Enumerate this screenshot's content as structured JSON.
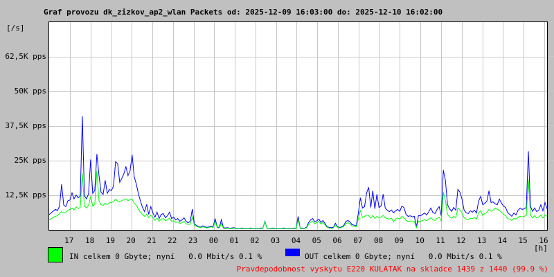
{
  "title": "Graf provozu dk_zizkov_ap2_wlan Packets od: 2025-12-09 16:03:00 do: 2025-12-10 16:02:00",
  "colors": {
    "in_series": "#00ff00",
    "out_series": "#0000ff",
    "grid": "#c6c6c6",
    "plot_background": "#ffffff",
    "page_background": "#c0c0c0",
    "alert_text": "#ff0000",
    "border": "#000000"
  },
  "y_axis": {
    "unit_label": "[/s]",
    "tick_labels": [
      "62,5K pps",
      "50K pps",
      "37,5K pps",
      "25K pps",
      "12,5K pps"
    ],
    "tick_values_kpps": [
      62.5,
      50,
      37.5,
      25,
      12.5
    ]
  },
  "x_axis": {
    "unit_label": "[h]",
    "tick_labels": [
      "17",
      "18",
      "19",
      "20",
      "21",
      "22",
      "23",
      "00",
      "01",
      "02",
      "03",
      "04",
      "05",
      "06",
      "07",
      "08",
      "09",
      "10",
      "11",
      "12",
      "13",
      "14",
      "15",
      "16"
    ]
  },
  "legend": {
    "in_label": "IN celkem 0 Gbyte; nyní   0.0 Mbit/s 0.1 %",
    "out_label": "OUT celkem 0 Gbyte; nyní   0.0 Mbit/s 0.1 %"
  },
  "footer": {
    "note": "Pravdepodobnost vyskytu E220 KULATAK na skladce 1439 z 1440 (99.9 %)"
  },
  "chart_data": {
    "type": "line",
    "title": "Graf provozu dk_zizkov_ap2_wlan Packets od: 2025-12-09 16:03:00 do: 2025-12-10 16:02:00",
    "x_start": "2025-12-09 16:03:00",
    "x_end": "2025-12-10 16:02:00",
    "x_step_minutes": 6,
    "xlabel": "[h]",
    "ylabel": "[/s]",
    "y_unit": "pps",
    "values_unit": "kpps",
    "ylim": [
      0,
      75
    ],
    "grid": true,
    "legend_position": "bottom",
    "y_gridlines_kpps": [
      12.5,
      25,
      37.5,
      50,
      62.5
    ],
    "series": [
      {
        "name": "OUT",
        "color": "#0000ff",
        "values": [
          5.5,
          6.2,
          6.8,
          7.4,
          7.0,
          8.6,
          16.5,
          9.0,
          8.4,
          10.5,
          10.8,
          13.4,
          11.2,
          12.6,
          11.6,
          12.2,
          41.0,
          12.4,
          11.2,
          13.1,
          25.4,
          13.2,
          14.3,
          27.4,
          19.8,
          13.6,
          12.8,
          17.9,
          13.2,
          14.6,
          14.2,
          15.8,
          24.6,
          23.9,
          17.2,
          18.6,
          20.2,
          22.9,
          19.6,
          21.3,
          27.1,
          19.2,
          16.6,
          13.1,
          10.4,
          8.1,
          6.6,
          9.2,
          5.6,
          8.4,
          6.1,
          4.6,
          6.4,
          4.1,
          5.6,
          5.9,
          4.4,
          5.1,
          6.4,
          4.1,
          4.6,
          3.6,
          4.1,
          3.1,
          3.6,
          4.4,
          3.1,
          2.6,
          3.1,
          7.5,
          2.1,
          1.6,
          1.2,
          1.0,
          1.5,
          1.2,
          0.9,
          1.1,
          1.4,
          1.2,
          4.1,
          1.0,
          0.9,
          3.7,
          0.8,
          0.7,
          0.8,
          0.6,
          0.7,
          0.8,
          0.6,
          0.5,
          0.6,
          0.7,
          0.5,
          0.6,
          0.5,
          0.7,
          0.6,
          0.5,
          0.6,
          0.5,
          0.7,
          0.6,
          3.1,
          0.6,
          0.5,
          0.6,
          0.7,
          0.5,
          0.5,
          0.6,
          0.5,
          0.7,
          0.6,
          0.5,
          0.6,
          0.5,
          0.7,
          0.6,
          4.9,
          0.6,
          0.7,
          0.6,
          0.9,
          2.6,
          3.6,
          4.1,
          2.9,
          3.3,
          3.9,
          2.7,
          3.4,
          2.3,
          1.1,
          0.9,
          0.8,
          0.9,
          2.4,
          1.1,
          0.9,
          1.1,
          1.6,
          3.1,
          3.4,
          2.9,
          1.9,
          1.7,
          1.5,
          5.9,
          11.6,
          7.9,
          8.4,
          13.4,
          15.4,
          8.1,
          14.1,
          7.6,
          12.9,
          8.1,
          8.6,
          12.9,
          7.9,
          7.1,
          6.6,
          7.2,
          6.2,
          6.9,
          7.4,
          6.7,
          8.6,
          8.1,
          5.6,
          4.9,
          5.1,
          4.7,
          4.9,
          1.1,
          5.2,
          5.1,
          5.6,
          6.1,
          5.4,
          6.6,
          7.9,
          6.2,
          5.9,
          7.4,
          8.4,
          5.1,
          21.6,
          17.9,
          9.1,
          7.6,
          6.7,
          8.1,
          7.1,
          14.6,
          13.6,
          11.1,
          7.1,
          6.2,
          5.9,
          6.9,
          6.4,
          7.1,
          6.1,
          10.4,
          12.1,
          9.1,
          9.6,
          10.4,
          14.1,
          9.9,
          10.1,
          9.4,
          9.1,
          11.1,
          9.7,
          8.6,
          8.1,
          6.2,
          5.6,
          4.9,
          6.1,
          5.4,
          7.1,
          7.9,
          7.4,
          7.6,
          8.1,
          28.4,
          8.6,
          6.7,
          7.9,
          6.6,
          7.1,
          9.1,
          6.9,
          9.9,
          7.6
        ]
      },
      {
        "name": "IN",
        "color": "#00ff00",
        "values": [
          3.6,
          4.1,
          4.5,
          4.9,
          5.1,
          5.9,
          6.6,
          6.1,
          6.3,
          7.1,
          7.4,
          7.9,
          7.2,
          8.3,
          7.7,
          8.1,
          20.4,
          8.6,
          7.9,
          8.9,
          12.1,
          8.6,
          9.3,
          21.4,
          10.6,
          9.1,
          8.9,
          9.6,
          9.2,
          9.8,
          9.9,
          10.2,
          11.1,
          10.4,
          10.1,
          10.6,
          10.9,
          11.2,
          10.6,
          10.9,
          11.1,
          9.6,
          8.9,
          7.6,
          6.3,
          5.6,
          4.9,
          5.7,
          4.4,
          5.3,
          4.4,
          3.4,
          4.3,
          3.1,
          3.9,
          4.1,
          3.3,
          3.6,
          4.3,
          3.1,
          3.3,
          2.7,
          2.9,
          2.3,
          2.6,
          3.1,
          2.3,
          1.9,
          2.1,
          4.6,
          1.6,
          1.3,
          1.0,
          0.8,
          1.1,
          0.9,
          0.7,
          0.9,
          1.1,
          0.9,
          3.1,
          0.8,
          0.7,
          2.4,
          0.6,
          0.5,
          0.6,
          0.5,
          0.5,
          0.6,
          0.5,
          0.4,
          0.5,
          0.5,
          0.4,
          0.5,
          0.4,
          0.5,
          0.5,
          0.4,
          0.5,
          0.4,
          0.5,
          0.5,
          2.9,
          0.5,
          0.4,
          0.5,
          0.5,
          0.4,
          0.4,
          0.5,
          0.4,
          0.5,
          0.5,
          0.4,
          0.5,
          0.4,
          0.5,
          0.5,
          3.6,
          0.5,
          0.5,
          0.5,
          0.7,
          1.9,
          2.7,
          3.2,
          2.2,
          2.6,
          3.1,
          2.1,
          2.7,
          1.8,
          0.9,
          0.7,
          0.6,
          0.7,
          1.9,
          0.9,
          0.7,
          0.9,
          1.3,
          2.3,
          2.6,
          2.2,
          1.4,
          1.3,
          1.1,
          3.9,
          7.1,
          4.4,
          4.9,
          5.4,
          5.1,
          4.3,
          5.2,
          4.1,
          4.9,
          4.4,
          4.7,
          5.2,
          4.4,
          4.1,
          3.9,
          4.2,
          2.9,
          3.9,
          4.3,
          3.9,
          4.9,
          4.4,
          3.4,
          3.1,
          3.2,
          2.9,
          3.1,
          0.8,
          3.2,
          3.1,
          3.4,
          3.7,
          3.3,
          3.9,
          4.4,
          3.6,
          3.4,
          4.2,
          4.6,
          3.2,
          13.6,
          10.6,
          5.6,
          4.7,
          4.2,
          4.9,
          4.4,
          7.9,
          7.2,
          6.1,
          4.4,
          3.9,
          3.7,
          4.2,
          4.1,
          4.4,
          3.9,
          6.1,
          6.9,
          5.2,
          5.9,
          6.4,
          7.4,
          6.7,
          7.1,
          7.9,
          7.4,
          7.1,
          6.4,
          5.7,
          5.1,
          4.1,
          3.9,
          3.4,
          4.2,
          3.9,
          4.6,
          4.9,
          4.7,
          4.9,
          5.2,
          17.9,
          5.4,
          4.4,
          5.1,
          4.3,
          4.7,
          5.4,
          4.3,
          5.4,
          4.9
        ]
      }
    ]
  }
}
